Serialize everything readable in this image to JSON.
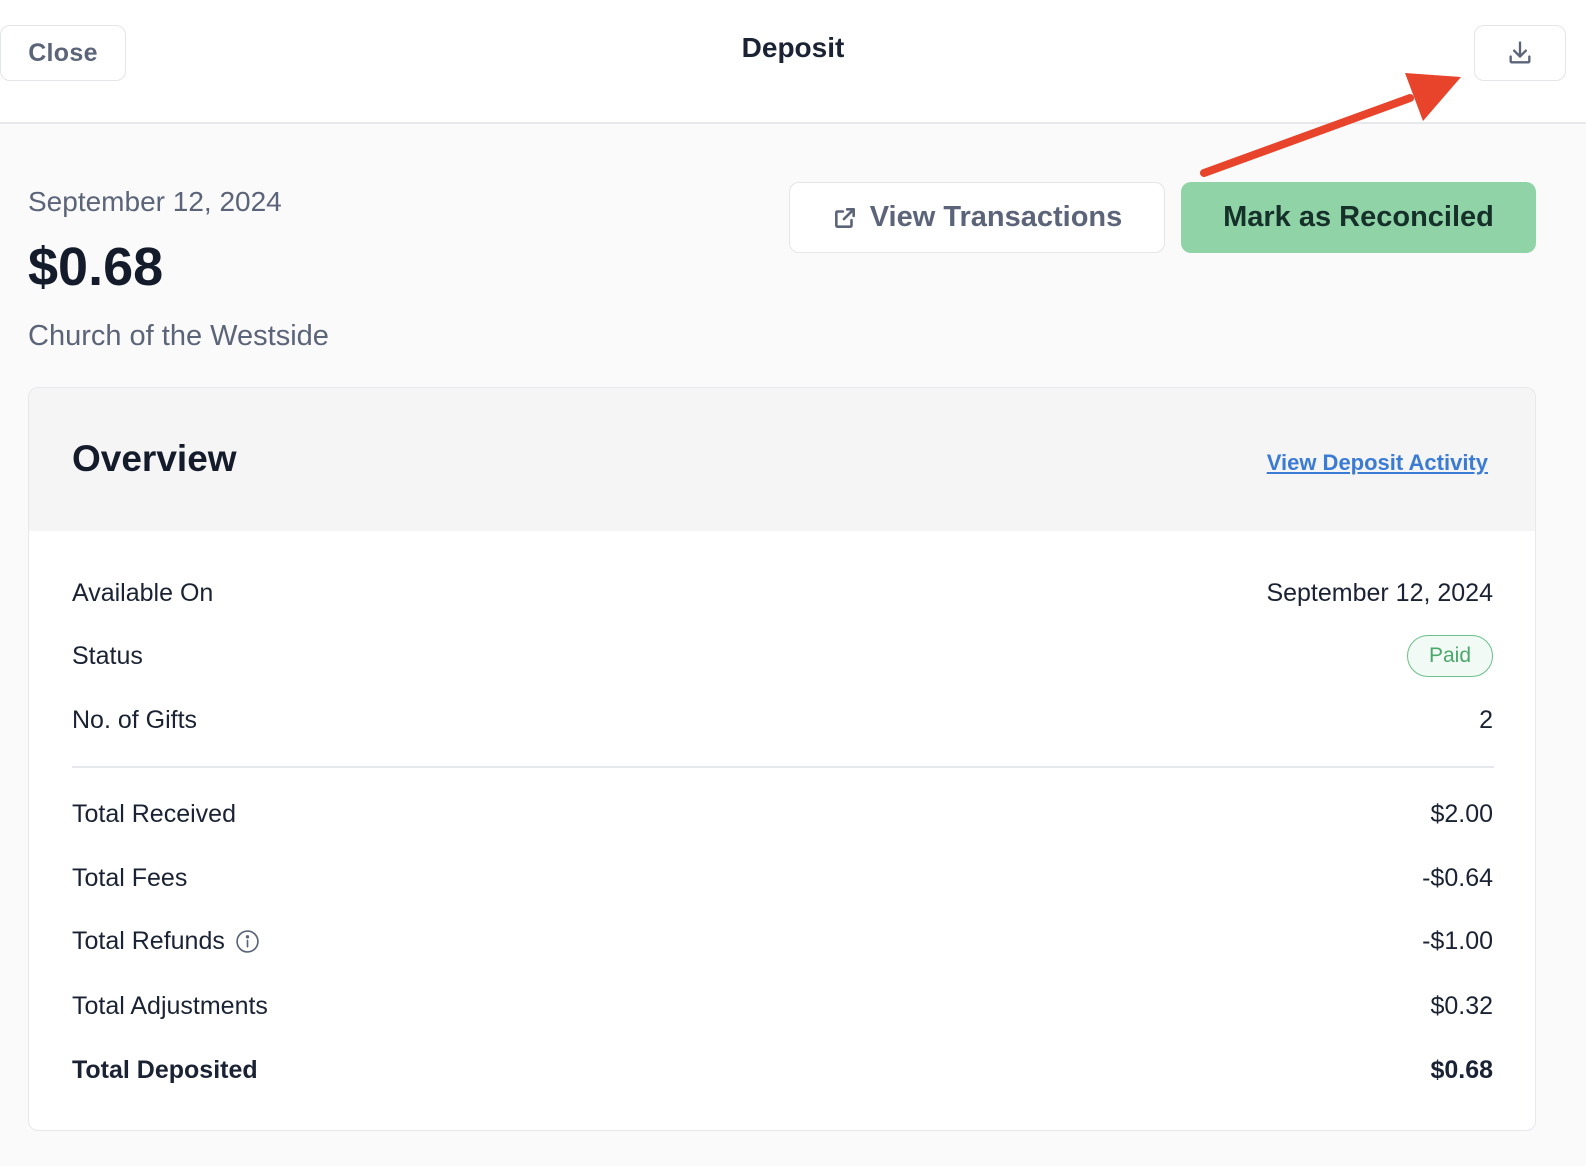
{
  "header": {
    "close_label": "Close",
    "title": "Deposit",
    "download_icon": "download-icon"
  },
  "summary": {
    "date": "September 12, 2024",
    "amount": "$0.68",
    "organization": "Church of the Westside"
  },
  "actions": {
    "view_transactions_label": "View Transactions",
    "view_transactions_icon": "external-link-icon",
    "reconcile_label": "Mark as Reconciled"
  },
  "overview": {
    "title": "Overview",
    "activity_link": "View Deposit Activity",
    "rows": [
      {
        "label": "Available On",
        "value": "September 12, 2024"
      },
      {
        "label": "Status",
        "value": "Paid"
      },
      {
        "label": "No. of Gifts",
        "value": "2"
      },
      {
        "label": "Total Received",
        "value": "$2.00"
      },
      {
        "label": "Total Fees",
        "value": "-$0.64"
      },
      {
        "label": "Total Refunds",
        "value": "-$1.00"
      },
      {
        "label": "Total Adjustments",
        "value": "$0.32"
      },
      {
        "label": "Total Deposited",
        "value": "$0.68"
      }
    ]
  },
  "colors": {
    "reconcile_button": "#8fd3a6",
    "paid_badge": "#4aa86b",
    "link": "#3a7bd5",
    "annotation_arrow": "#e8432b"
  }
}
